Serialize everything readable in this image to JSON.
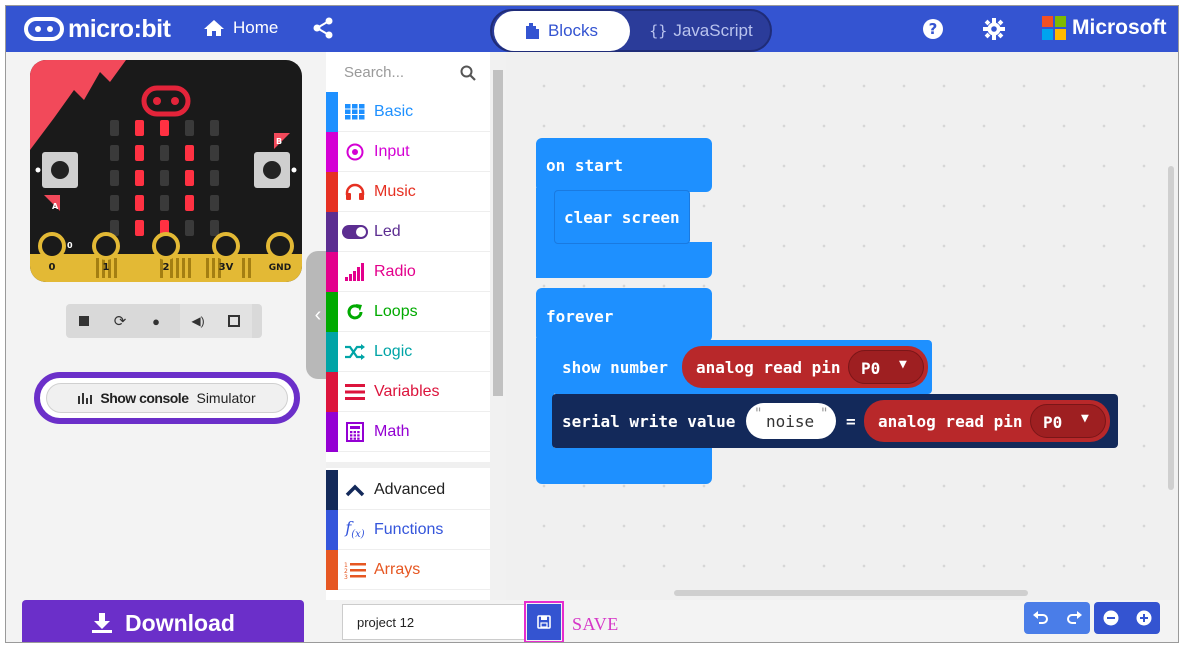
{
  "header": {
    "logo_text": "micro:bit",
    "home_label": "Home",
    "tabs": [
      {
        "label": "Blocks",
        "active": true
      },
      {
        "label": "JavaScript",
        "active": false
      }
    ],
    "js_glyph": "{}",
    "brand": "Microsoft",
    "icons": [
      "home-icon",
      "share-icon",
      "help-icon",
      "settings-icon"
    ]
  },
  "simulator": {
    "pins": [
      "0",
      "1",
      "2",
      "3V",
      "GND"
    ],
    "button_a": "A",
    "button_b": "B",
    "pin_hint": "0",
    "led_grid": [
      [
        0,
        1,
        1,
        0,
        0
      ],
      [
        0,
        1,
        0,
        1,
        0
      ],
      [
        0,
        1,
        0,
        1,
        0
      ],
      [
        0,
        1,
        0,
        1,
        0
      ],
      [
        0,
        1,
        1,
        0,
        0
      ]
    ],
    "controls": [
      "stop-icon",
      "restart-icon",
      "debug-icon",
      "mute-icon",
      "fullscreen-icon"
    ],
    "console_button": {
      "bold": "Show console",
      "rest": "Simulator"
    }
  },
  "toolbox": {
    "search_placeholder": "Search...",
    "categories": [
      {
        "label": "Basic",
        "color": "#1e90ff",
        "icon": "grid-icon"
      },
      {
        "label": "Input",
        "color": "#d400d4",
        "icon": "target-icon"
      },
      {
        "label": "Music",
        "color": "#e63022",
        "icon": "headphones-icon"
      },
      {
        "label": "Led",
        "color": "#5c2d91",
        "icon": "toggle-icon"
      },
      {
        "label": "Radio",
        "color": "#e3008c",
        "icon": "signal-icon"
      },
      {
        "label": "Loops",
        "color": "#00aa00",
        "icon": "refresh-icon"
      },
      {
        "label": "Logic",
        "color": "#00a4a6",
        "icon": "shuffle-icon"
      },
      {
        "label": "Variables",
        "color": "#dc143c",
        "icon": "list-icon"
      },
      {
        "label": "Math",
        "color": "#9400d3",
        "icon": "calculator-icon"
      },
      {
        "label": "Advanced",
        "color": "#13295a",
        "icon": "chevron-up-icon"
      },
      {
        "label": "Functions",
        "color": "#3455db",
        "icon": "function-icon"
      },
      {
        "label": "Arrays",
        "color": "#e65722",
        "icon": "arrays-icon"
      }
    ]
  },
  "workspace": {
    "on_start": "on start",
    "clear_screen": "clear screen",
    "forever": "forever",
    "show_number": "show number",
    "analog_read_1": "analog read pin",
    "pin_1": "P0",
    "serial_write": "serial write value",
    "serial_name": "noise",
    "equals": "=",
    "analog_read_2": "analog read pin",
    "pin_2": "P0"
  },
  "bottom": {
    "download_label": "Download",
    "project_name": "project 12",
    "save_annotation": "SAVE",
    "controls": [
      "undo-icon",
      "redo-icon",
      "zoom-out-icon",
      "zoom-in-icon"
    ]
  }
}
